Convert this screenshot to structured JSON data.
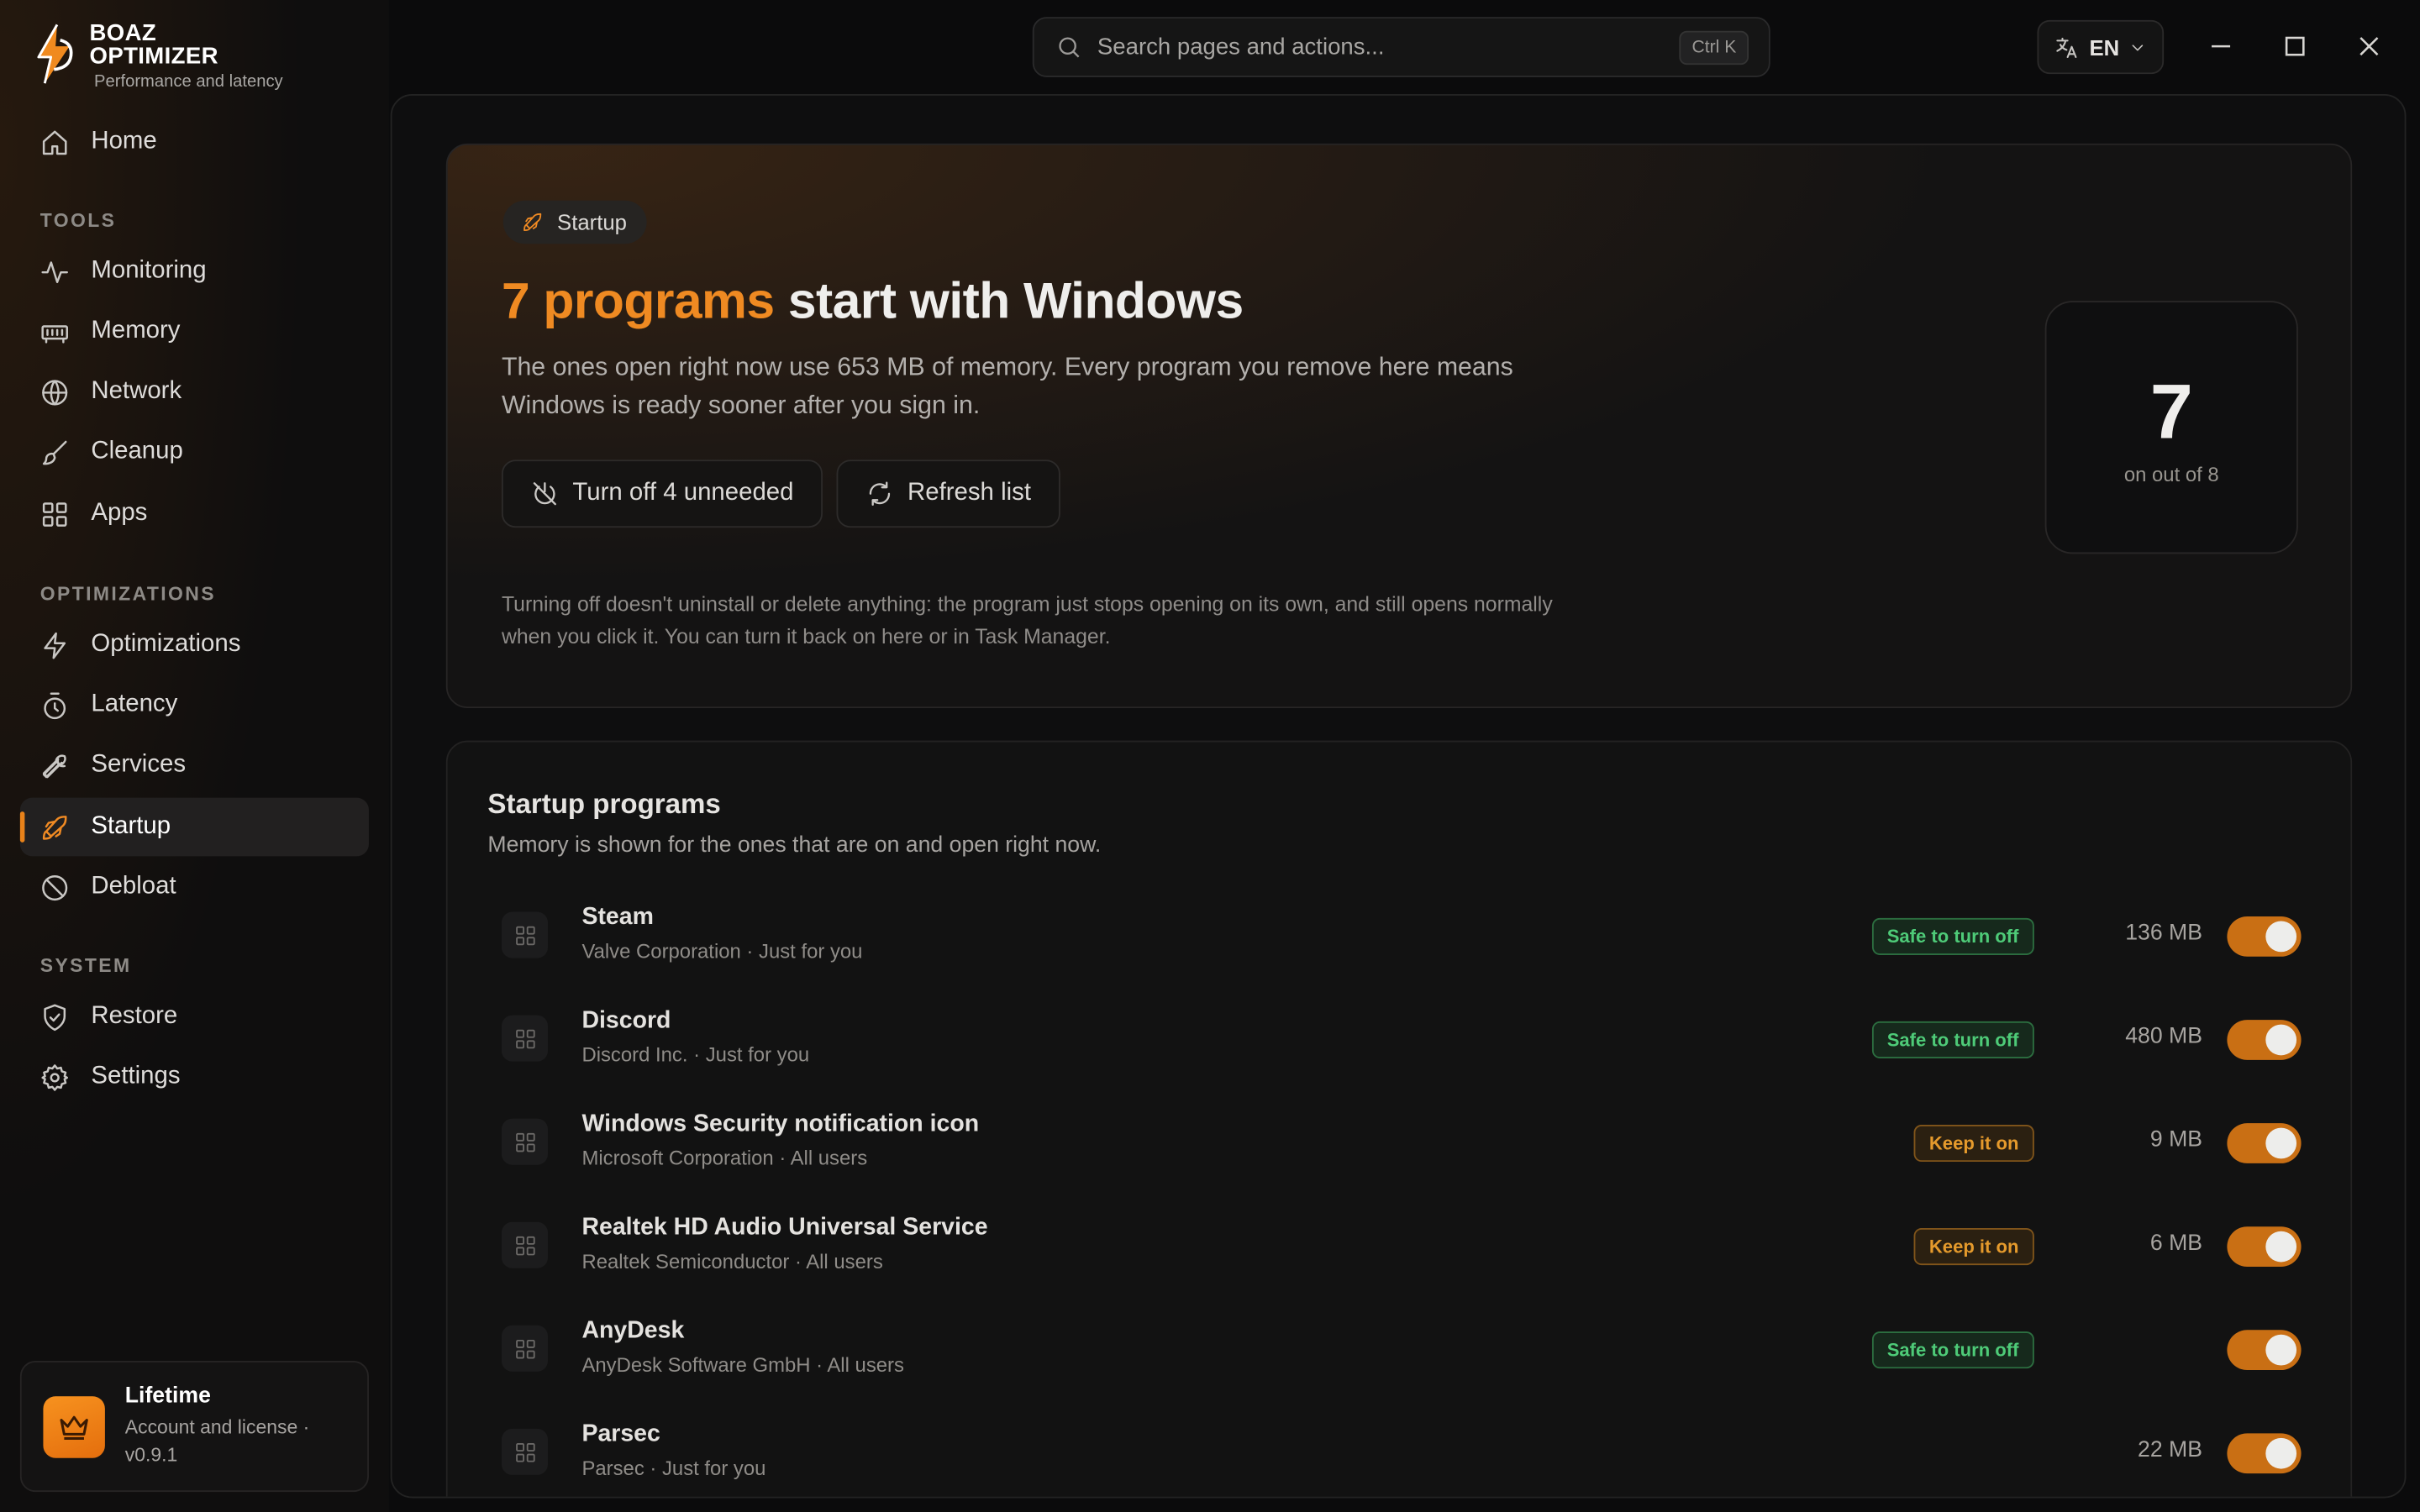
{
  "brand": {
    "name": "BOAZ OPTIMIZER",
    "tagline": "Performance and latency",
    "accent_color": "#ef8a22"
  },
  "search": {
    "placeholder": "Search pages and actions...",
    "shortcut": "Ctrl K",
    "icon": "search-icon"
  },
  "language": {
    "label": "EN",
    "icon": "translate-icon"
  },
  "window_controls": [
    "minimize-icon",
    "maximize-icon",
    "close-icon"
  ],
  "sidebar": {
    "home": {
      "label": "Home",
      "icon": "home-icon"
    },
    "sections": [
      {
        "title": "TOOLS",
        "items": [
          {
            "label": "Monitoring",
            "icon": "activity-icon"
          },
          {
            "label": "Memory",
            "icon": "memory-icon"
          },
          {
            "label": "Network",
            "icon": "globe-icon"
          },
          {
            "label": "Cleanup",
            "icon": "brush-icon"
          },
          {
            "label": "Apps",
            "icon": "grid-icon"
          }
        ]
      },
      {
        "title": "OPTIMIZATIONS",
        "items": [
          {
            "label": "Optimizations",
            "icon": "lightning-icon"
          },
          {
            "label": "Latency",
            "icon": "timer-icon"
          },
          {
            "label": "Services",
            "icon": "wrench-icon"
          },
          {
            "label": "Startup",
            "icon": "rocket-icon",
            "active": true
          },
          {
            "label": "Debloat",
            "icon": "ban-icon"
          }
        ]
      },
      {
        "title": "SYSTEM",
        "items": [
          {
            "label": "Restore",
            "icon": "shield-icon"
          },
          {
            "label": "Settings",
            "icon": "gear-icon"
          }
        ]
      }
    ],
    "license": {
      "title": "Lifetime",
      "subtitle": "Account and license ·",
      "version": "v0.9.1",
      "icon": "crown-icon"
    }
  },
  "hero": {
    "chip": "Startup",
    "title_accent": "7 programs",
    "title_rest": " start with Windows",
    "description": "The ones open right now use 653 MB of memory. Every program you remove here means Windows is ready sooner after you sign in.",
    "turn_off_label": "Turn off 4 unneeded",
    "refresh_label": "Refresh list",
    "note": "Turning off doesn't uninstall or delete anything: the program just stops opening on its own, and still opens normally when you click it. You can turn it back on here or in Task Manager.",
    "count": "7",
    "count_label": "on out of 8"
  },
  "list": {
    "title": "Startup programs",
    "subtitle": "Memory is shown for the ones that are on and open right now.",
    "rows": [
      {
        "name": "Steam",
        "meta": "Valve Corporation · Just for you",
        "badge": "Safe to turn off",
        "badge_type": "safe",
        "memory": "136 MB",
        "enabled": true
      },
      {
        "name": "Discord",
        "meta": "Discord Inc. · Just for you",
        "badge": "Safe to turn off",
        "badge_type": "safe",
        "memory": "480 MB",
        "enabled": true
      },
      {
        "name": "Windows Security notification icon",
        "meta": "Microsoft Corporation · All users",
        "badge": "Keep it on",
        "badge_type": "keep",
        "memory": "9 MB",
        "enabled": true
      },
      {
        "name": "Realtek HD Audio Universal Service",
        "meta": "Realtek Semiconductor · All users",
        "badge": "Keep it on",
        "badge_type": "keep",
        "memory": "6 MB",
        "enabled": true
      },
      {
        "name": "AnyDesk",
        "meta": "AnyDesk Software GmbH · All users",
        "badge": "Safe to turn off",
        "badge_type": "safe",
        "memory": "",
        "enabled": true
      },
      {
        "name": "Parsec",
        "meta": "Parsec · Just for you",
        "badge": "",
        "badge_type": "",
        "memory": "22 MB",
        "enabled": true
      }
    ]
  }
}
